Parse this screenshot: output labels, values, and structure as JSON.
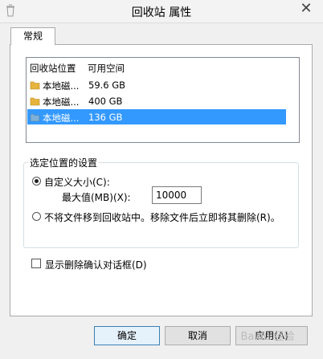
{
  "window": {
    "title": "回收站 属性",
    "close_glyph": "✕"
  },
  "tabs": [
    {
      "label": "常规"
    }
  ],
  "listview": {
    "columns": [
      "回收站位置",
      "可用空间"
    ],
    "rows": [
      {
        "name": "本地磁...",
        "size": "59.6 GB",
        "selected": false
      },
      {
        "name": "本地磁...",
        "size": "400 GB",
        "selected": false
      },
      {
        "name": "本地磁...",
        "size": "136 GB",
        "selected": true
      }
    ]
  },
  "settings": {
    "group_label": "选定位置的设置",
    "custom_size_label": "自定义大小(C):",
    "max_label": "最大值(MB)(X):",
    "max_value": "10000",
    "no_move_label": "不将文件移到回收站中。移除文件后立即将其删除(R)。",
    "custom_selected": true
  },
  "confirm": {
    "label": "显示删除确认对话框(D)",
    "checked": false
  },
  "buttons": {
    "ok": "确定",
    "cancel": "取消",
    "apply": "应用(A)"
  },
  "watermark": "Baidu 经验",
  "colors": {
    "selection": "#3399ff",
    "folder": "#e6b43c",
    "selected_folder": "#7fb0d8"
  }
}
